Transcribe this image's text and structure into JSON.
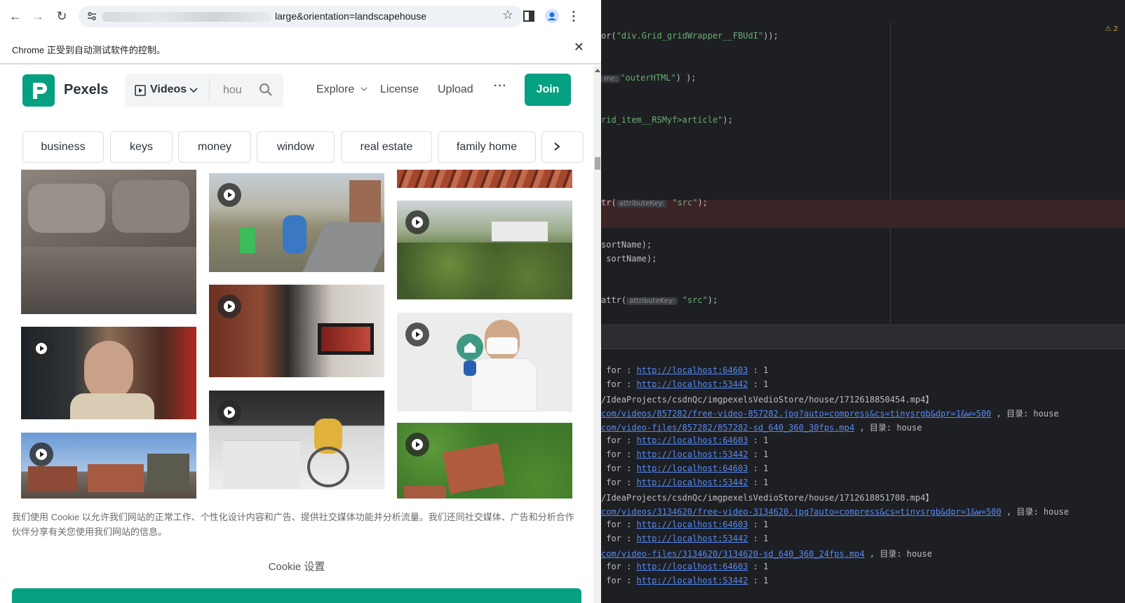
{
  "browser": {
    "url_visible": "large&orientation=landscapehouse",
    "infobar_text": "Chrome 正受到自动测试软件的控制。"
  },
  "pexels": {
    "brand": "Pexels",
    "search_type": "Videos",
    "search_query": "hou",
    "nav": [
      "Explore",
      "License",
      "Upload"
    ],
    "join_label": "Join",
    "chips": [
      "business",
      "keys",
      "money",
      "window",
      "real estate",
      "family home"
    ],
    "cookie_text": "我们使用 Cookie 以允许我们网站的正常工作、个性化设计内容和广告、提供社交媒体功能并分析流量。我们还同社交媒体、广告和分析合作伙伴分享有关您使用我们网站的信息。",
    "cookie_settings": "Cookie 设置"
  },
  "ide": {
    "warning_count": "2",
    "code": {
      "l1_a": "or(",
      "l1_b": "\"div.Grid_gridWrapper__FBUdI\"",
      "l1_c": "));",
      "l2_hint": "me:",
      "l2_b": "\"outerHTML\"",
      "l2_c": ") );",
      "l3_a": "rid_item__RSMyf>article\"",
      "l3_c": ");",
      "l4_a": "tr(",
      "l4_hint": "attributeKey:",
      "l4_b": "\"src\"",
      "l4_c": ");",
      "l5": "sortName);",
      "l6": " sortName);",
      "l7_a": "attr(",
      "l7_hint": "attributeKey:",
      "l7_b": "\"src\"",
      "l7_c": ");"
    },
    "console": {
      "for_prefix": " for : ",
      "sep": " : ",
      "one": "1",
      "link_a": "http://localhost:64603",
      "link_b": "http://localhost:53442",
      "path1": "/IdeaProjects/csdnQc/imgpexelsVedioStore/house/1712618850454.mp4】",
      "img1": "com/videos/857282/free-video-857282.jpg?auto=compress&cs=tinysrgb&dpr=1&w=500",
      "vid1": "com/video-files/857282/857282-sd_640_360_30fps.mp4",
      "path2": "/IdeaProjects/csdnQc/imgpexelsVedioStore/house/1712618851708.mp4】",
      "img2": "com/videos/3134620/free-video-3134620.jpg?auto=compress&cs=tinysrgb&dpr=1&w=500",
      "vid2": "com/video-files/3134620/3134620-sd_640_360_24fps.mp4",
      "dir_label": " , 目录: house"
    }
  }
}
